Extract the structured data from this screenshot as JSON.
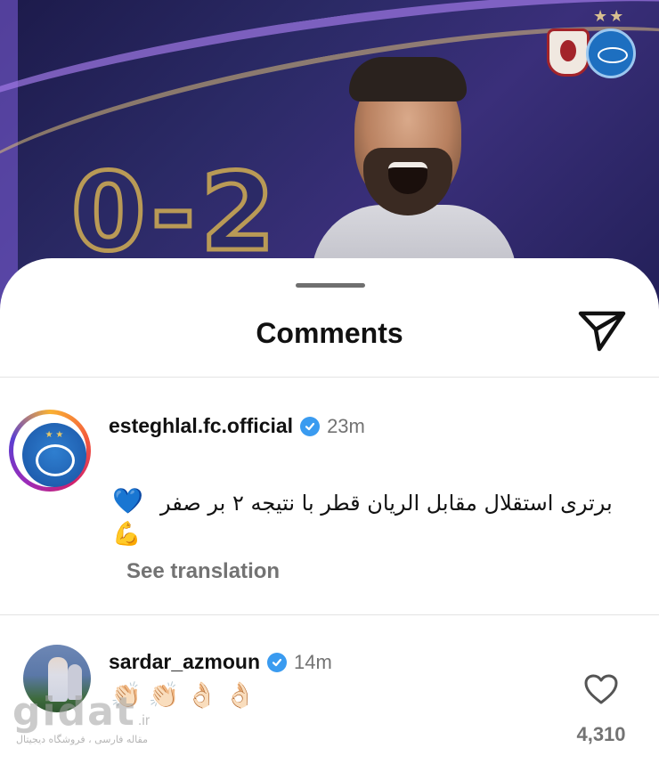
{
  "post": {
    "score": "0-2",
    "stars": "★★"
  },
  "sheet": {
    "title": "Comments"
  },
  "comments": [
    {
      "username": "esteghlal.fc.official",
      "verified": true,
      "time": "23m",
      "text": "برتری استقلال مقابل الریان قطر با نتیجه ۲ بر صفر",
      "emojis": [
        "💙",
        "💪"
      ],
      "see_translation": "See translation"
    },
    {
      "username": "sardar_azmoun",
      "verified": true,
      "time": "14m",
      "emojis": [
        "👏🏻",
        "👏🏻",
        "👌🏻",
        "👌🏻"
      ],
      "likes": "4,310"
    }
  ],
  "watermark": {
    "logo": "gidat",
    "tld": ".ir",
    "subtitle": "مقاله فارسی ، فروشگاه دیجیتال"
  },
  "colors": {
    "verified": "#3a9bf0",
    "muted_text": "#737373",
    "accent_purple": "#2b2a66"
  }
}
